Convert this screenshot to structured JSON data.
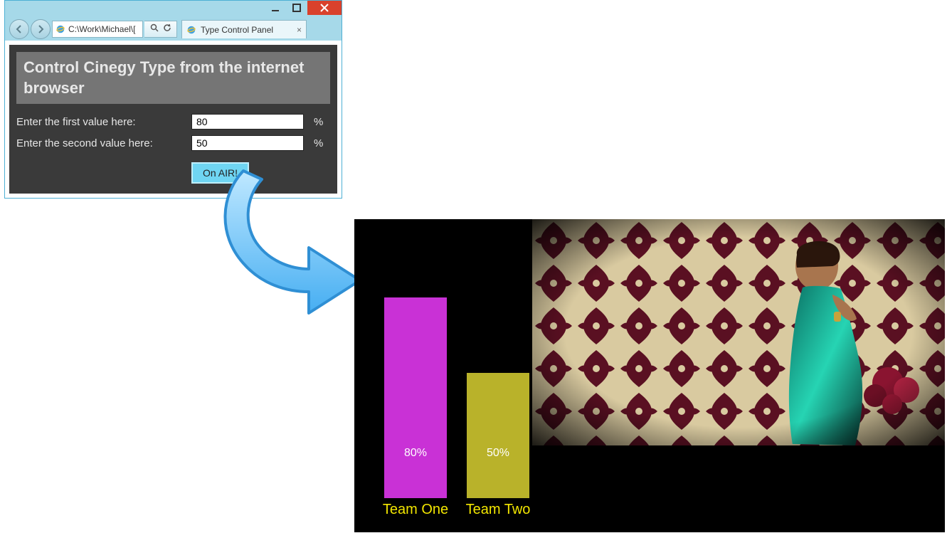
{
  "browser": {
    "window_controls": {
      "minimize": "minimize",
      "maximize": "maximize",
      "close": "close"
    },
    "url": "C:\\Work\\Michael\\[",
    "tab_title": "Type Control Panel"
  },
  "panel": {
    "heading": "Control Cinegy Type from the internet browser",
    "row1": {
      "label": "Enter the first value here:",
      "value": "80",
      "suffix": "%"
    },
    "row2": {
      "label": "Enter the second value here:",
      "value": "50",
      "suffix": "%"
    },
    "submit_label": "On AIR!"
  },
  "chart_data": {
    "type": "bar",
    "categories": [
      "Team One",
      "Team Two"
    ],
    "values": [
      80,
      50
    ],
    "value_labels": [
      "80%",
      "50%"
    ],
    "colors": [
      "#c931d6",
      "#b9b22a"
    ],
    "ylim": [
      0,
      100
    ],
    "title": "",
    "xlabel": "",
    "ylabel": ""
  }
}
